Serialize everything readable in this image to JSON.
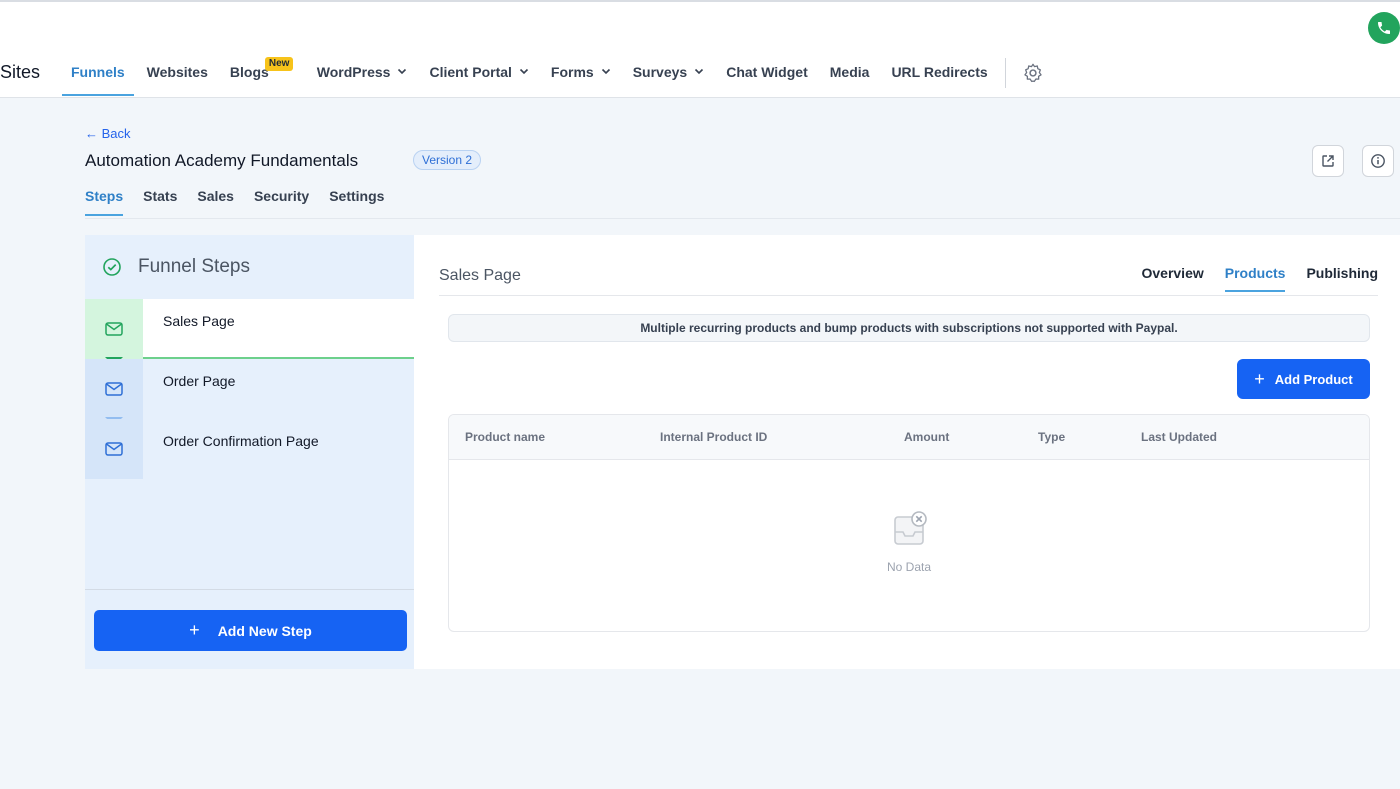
{
  "app": {
    "brand": "Sites"
  },
  "nav": {
    "items": [
      {
        "label": "Funnels",
        "active": true
      },
      {
        "label": "Websites"
      },
      {
        "label": "Blogs",
        "badge": "New"
      },
      {
        "label": "WordPress",
        "dropdown": true
      },
      {
        "label": "Client Portal",
        "dropdown": true
      },
      {
        "label": "Forms",
        "dropdown": true
      },
      {
        "label": "Surveys",
        "dropdown": true
      },
      {
        "label": "Chat Widget"
      },
      {
        "label": "Media"
      },
      {
        "label": "URL Redirects"
      }
    ]
  },
  "header": {
    "back_label": "← Back",
    "title": "Automation Academy Fundamentals",
    "version": "Version 2",
    "tabs": [
      "Steps",
      "Stats",
      "Sales",
      "Security",
      "Settings"
    ]
  },
  "steps": {
    "header": "Funnel Steps",
    "items": [
      "Sales Page",
      "Order Page",
      "Order Confirmation Page"
    ],
    "add_label": "Add New Step"
  },
  "main": {
    "page_name": "Sales Page",
    "tabs": [
      "Overview",
      "Products",
      "Publishing"
    ],
    "notice": "Multiple recurring products and bump products with subscriptions not supported with Paypal.",
    "add_product_label": "Add Product",
    "table": {
      "columns": [
        "Product name",
        "Internal Product ID",
        "Amount",
        "Type",
        "Last Updated"
      ],
      "empty_text": "No Data"
    }
  },
  "colors": {
    "accent": "#1663f3",
    "active_tab": "#2f80c7",
    "success": "#22a45d",
    "badge": "#f7c31a"
  }
}
